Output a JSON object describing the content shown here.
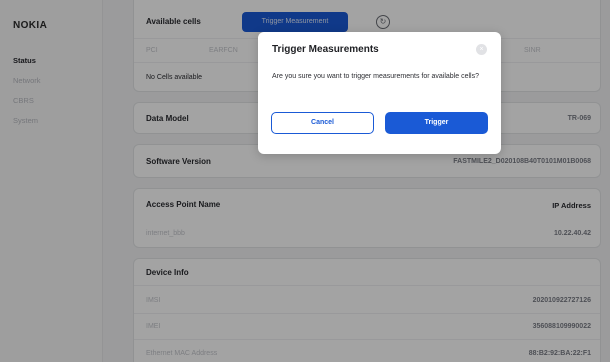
{
  "sidebar": {
    "logo": "NOKIA",
    "items": [
      {
        "label": "Status"
      },
      {
        "label": "Network"
      },
      {
        "label": "CBRS"
      },
      {
        "label": "System"
      }
    ]
  },
  "cells": {
    "title": "Available cells",
    "trigger_label": "Trigger Measurement",
    "refresh_icon": "↻",
    "columns": [
      "PCI",
      "EARFCN",
      "SINR"
    ],
    "empty_text": "No Cells available"
  },
  "data_model": {
    "title": "Data Model",
    "value": "TR-069"
  },
  "software": {
    "title": "Software Version",
    "value": "FASTMILE2_D020108B40T0101M01B0068"
  },
  "apn": {
    "title": "Access Point Name",
    "ip_header": "IP Address",
    "name": "internet_bbb",
    "ip": "10.22.40.42"
  },
  "device": {
    "title": "Device Info",
    "rows": [
      {
        "label": "IMSI",
        "value": "202010922727126"
      },
      {
        "label": "IMEI",
        "value": "356088109990022"
      },
      {
        "label": "Ethernet MAC Address",
        "value": "88:B2:92:BA:22:F1"
      }
    ]
  },
  "modal": {
    "title": "Trigger Measurements",
    "close_icon": "×",
    "message": "Are you sure you want to trigger measurements for available cells?",
    "cancel": "Cancel",
    "confirm": "Trigger"
  }
}
